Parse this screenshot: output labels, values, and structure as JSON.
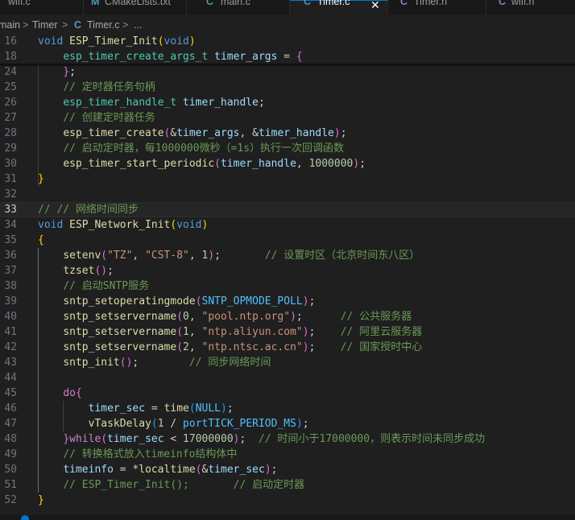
{
  "tabs": [
    {
      "icon": "",
      "label": "wifi.c",
      "active": false,
      "icon_color": "#519aba"
    },
    {
      "icon": "M",
      "label": "CMakeLists.txt",
      "active": false,
      "icon_color": "#519aba"
    },
    {
      "icon": "C",
      "label": "main.c",
      "active": false,
      "icon_color": "#519aba"
    },
    {
      "icon": "C",
      "label": "Timer.c",
      "active": true,
      "icon_color": "#519aba",
      "close": "✕"
    },
    {
      "icon": "C",
      "label": "Timer.h",
      "active": false,
      "icon_color": "#a074c4"
    },
    {
      "icon": "C",
      "label": "wifi.h",
      "active": false,
      "icon_color": "#a074c4"
    }
  ],
  "breadcrumb": {
    "part1": "main",
    "sep": ">",
    "part2": "Timer",
    "file_icon": "C",
    "file": "Timer.c",
    "tail": "..."
  },
  "colors": {
    "keyword": "#569cd6",
    "control": "#c586c0",
    "function": "#dcdcaa",
    "type": "#4ec9b0",
    "variable": "#9cdcfe",
    "string": "#ce9178",
    "number": "#b5cea8",
    "comment": "#6a9955",
    "macro": "#4fc1ff",
    "plain": "#cccccc",
    "brace": "#ffd700",
    "paren": "#da70d6",
    "paren2": "#179fff"
  },
  "lines": [
    {
      "n": "16",
      "t": [
        [
          "void",
          "keyword"
        ],
        [
          " ",
          "plain"
        ],
        [
          "ESP_Timer_Init",
          "function"
        ],
        [
          "(",
          "brace"
        ],
        [
          "void",
          "keyword"
        ],
        [
          ")",
          "brace"
        ]
      ]
    },
    {
      "n": "18",
      "t": [
        [
          "    ",
          "plain"
        ],
        [
          "esp_timer_create_args_t",
          "type"
        ],
        [
          " ",
          "plain"
        ],
        [
          "timer_args",
          "variable"
        ],
        [
          " = ",
          "plain"
        ],
        [
          "{",
          "paren"
        ]
      ]
    },
    {
      "n": "24",
      "t": [
        [
          "    ",
          "plain"
        ],
        [
          "}",
          "paren"
        ],
        [
          ";",
          "plain"
        ]
      ]
    },
    {
      "n": "25",
      "t": [
        [
          "    ",
          "plain"
        ],
        [
          "// 定时器任务句柄",
          "comment"
        ]
      ]
    },
    {
      "n": "26",
      "t": [
        [
          "    ",
          "plain"
        ],
        [
          "esp_timer_handle_t",
          "type"
        ],
        [
          " ",
          "plain"
        ],
        [
          "timer_handle",
          "variable"
        ],
        [
          ";",
          "plain"
        ]
      ]
    },
    {
      "n": "27",
      "t": [
        [
          "    ",
          "plain"
        ],
        [
          "// 创建定时器任务",
          "comment"
        ]
      ]
    },
    {
      "n": "28",
      "t": [
        [
          "    ",
          "plain"
        ],
        [
          "esp_timer_create",
          "function"
        ],
        [
          "(",
          "paren"
        ],
        [
          "&",
          "plain"
        ],
        [
          "timer_args",
          "variable"
        ],
        [
          ", &",
          "plain"
        ],
        [
          "timer_handle",
          "variable"
        ],
        [
          ")",
          "paren"
        ],
        [
          ";",
          "plain"
        ]
      ]
    },
    {
      "n": "29",
      "t": [
        [
          "    ",
          "plain"
        ],
        [
          "// 启动定时器，每1000000微秒（=1s）执行一次回调函数",
          "comment"
        ]
      ]
    },
    {
      "n": "30",
      "t": [
        [
          "    ",
          "plain"
        ],
        [
          "esp_timer_start_periodic",
          "function"
        ],
        [
          "(",
          "paren"
        ],
        [
          "timer_handle",
          "variable"
        ],
        [
          ", ",
          "plain"
        ],
        [
          "1000000",
          "number"
        ],
        [
          ")",
          "paren"
        ],
        [
          ";",
          "plain"
        ]
      ]
    },
    {
      "n": "31",
      "t": [
        [
          "}",
          "brace"
        ]
      ]
    },
    {
      "n": "32",
      "t": []
    },
    {
      "n": "33",
      "t": [
        [
          "// // 网络时间同步",
          "comment"
        ]
      ]
    },
    {
      "n": "34",
      "t": [
        [
          "void",
          "keyword"
        ],
        [
          " ",
          "plain"
        ],
        [
          "ESP_Network_Init",
          "function"
        ],
        [
          "(",
          "brace"
        ],
        [
          "void",
          "keyword"
        ],
        [
          ")",
          "brace"
        ]
      ]
    },
    {
      "n": "35",
      "t": [
        [
          "{",
          "brace"
        ]
      ]
    },
    {
      "n": "36",
      "t": [
        [
          "    ",
          "plain"
        ],
        [
          "setenv",
          "function"
        ],
        [
          "(",
          "paren"
        ],
        [
          "\"TZ\"",
          "string"
        ],
        [
          ", ",
          "plain"
        ],
        [
          "\"CST-8\"",
          "string"
        ],
        [
          ", ",
          "plain"
        ],
        [
          "1",
          "number"
        ],
        [
          ")",
          "paren"
        ],
        [
          ";       ",
          "plain"
        ],
        [
          "// 设置时区（北京时间东八区）",
          "comment"
        ]
      ]
    },
    {
      "n": "37",
      "t": [
        [
          "    ",
          "plain"
        ],
        [
          "tzset",
          "function"
        ],
        [
          "()",
          "paren"
        ],
        [
          ";",
          "plain"
        ]
      ]
    },
    {
      "n": "38",
      "t": [
        [
          "    ",
          "plain"
        ],
        [
          "// 启动SNTP服务",
          "comment"
        ]
      ]
    },
    {
      "n": "39",
      "t": [
        [
          "    ",
          "plain"
        ],
        [
          "sntp_setoperatingmode",
          "function"
        ],
        [
          "(",
          "paren"
        ],
        [
          "SNTP_OPMODE_POLL",
          "macro"
        ],
        [
          ")",
          "paren"
        ],
        [
          ";",
          "plain"
        ]
      ]
    },
    {
      "n": "40",
      "t": [
        [
          "    ",
          "plain"
        ],
        [
          "sntp_setservername",
          "function"
        ],
        [
          "(",
          "paren"
        ],
        [
          "0",
          "number"
        ],
        [
          ", ",
          "plain"
        ],
        [
          "\"pool.ntp.org\"",
          "string"
        ],
        [
          ")",
          "paren"
        ],
        [
          ";      ",
          "plain"
        ],
        [
          "// 公共服务器",
          "comment"
        ]
      ]
    },
    {
      "n": "41",
      "t": [
        [
          "    ",
          "plain"
        ],
        [
          "sntp_setservername",
          "function"
        ],
        [
          "(",
          "paren"
        ],
        [
          "1",
          "number"
        ],
        [
          ", ",
          "plain"
        ],
        [
          "\"ntp.aliyun.com\"",
          "string"
        ],
        [
          ")",
          "paren"
        ],
        [
          ";    ",
          "plain"
        ],
        [
          "// 阿里云服务器",
          "comment"
        ]
      ]
    },
    {
      "n": "42",
      "t": [
        [
          "    ",
          "plain"
        ],
        [
          "sntp_setservername",
          "function"
        ],
        [
          "(",
          "paren"
        ],
        [
          "2",
          "number"
        ],
        [
          ", ",
          "plain"
        ],
        [
          "\"ntp.ntsc.ac.cn\"",
          "string"
        ],
        [
          ")",
          "paren"
        ],
        [
          ";    ",
          "plain"
        ],
        [
          "// 国家授时中心",
          "comment"
        ]
      ]
    },
    {
      "n": "43",
      "t": [
        [
          "    ",
          "plain"
        ],
        [
          "sntp_init",
          "function"
        ],
        [
          "()",
          "paren"
        ],
        [
          ";        ",
          "plain"
        ],
        [
          "// 同步网络时间",
          "comment"
        ]
      ]
    },
    {
      "n": "44",
      "t": []
    },
    {
      "n": "45",
      "t": [
        [
          "    ",
          "plain"
        ],
        [
          "do",
          "control"
        ],
        [
          "{",
          "paren"
        ]
      ]
    },
    {
      "n": "46",
      "t": [
        [
          "        ",
          "plain"
        ],
        [
          "timer_sec",
          "variable"
        ],
        [
          " = ",
          "plain"
        ],
        [
          "time",
          "function"
        ],
        [
          "(",
          "paren2"
        ],
        [
          "NULL",
          "macro"
        ],
        [
          ")",
          "paren2"
        ],
        [
          ";",
          "plain"
        ]
      ]
    },
    {
      "n": "47",
      "t": [
        [
          "        ",
          "plain"
        ],
        [
          "vTaskDelay",
          "function"
        ],
        [
          "(",
          "paren2"
        ],
        [
          "1",
          "number"
        ],
        [
          " / ",
          "plain"
        ],
        [
          "portTICK_PERIOD_MS",
          "macro"
        ],
        [
          ")",
          "paren2"
        ],
        [
          ";",
          "plain"
        ]
      ]
    },
    {
      "n": "48",
      "t": [
        [
          "    ",
          "plain"
        ],
        [
          "}",
          "paren"
        ],
        [
          "while",
          "control"
        ],
        [
          "(",
          "paren"
        ],
        [
          "timer_sec",
          "variable"
        ],
        [
          " < ",
          "plain"
        ],
        [
          "17000000",
          "number"
        ],
        [
          ")",
          "paren"
        ],
        [
          ";  ",
          "plain"
        ],
        [
          "// 时间小于17000000，则表示时间未同步成功",
          "comment"
        ]
      ]
    },
    {
      "n": "49",
      "t": [
        [
          "    ",
          "plain"
        ],
        [
          "// 转换格式放入timeinfo结构体中",
          "comment"
        ]
      ]
    },
    {
      "n": "50",
      "t": [
        [
          "    ",
          "plain"
        ],
        [
          "timeinfo",
          "variable"
        ],
        [
          " = *",
          "plain"
        ],
        [
          "localtime",
          "function"
        ],
        [
          "(",
          "paren"
        ],
        [
          "&",
          "plain"
        ],
        [
          "timer_sec",
          "variable"
        ],
        [
          ")",
          "paren"
        ],
        [
          ";",
          "plain"
        ]
      ]
    },
    {
      "n": "51",
      "t": [
        [
          "    ",
          "plain"
        ],
        [
          "// ESP_Timer_Init();       // 启动定时器",
          "comment"
        ]
      ]
    },
    {
      "n": "52",
      "t": [
        [
          "}",
          "brace"
        ]
      ]
    }
  ],
  "current_line": "33"
}
